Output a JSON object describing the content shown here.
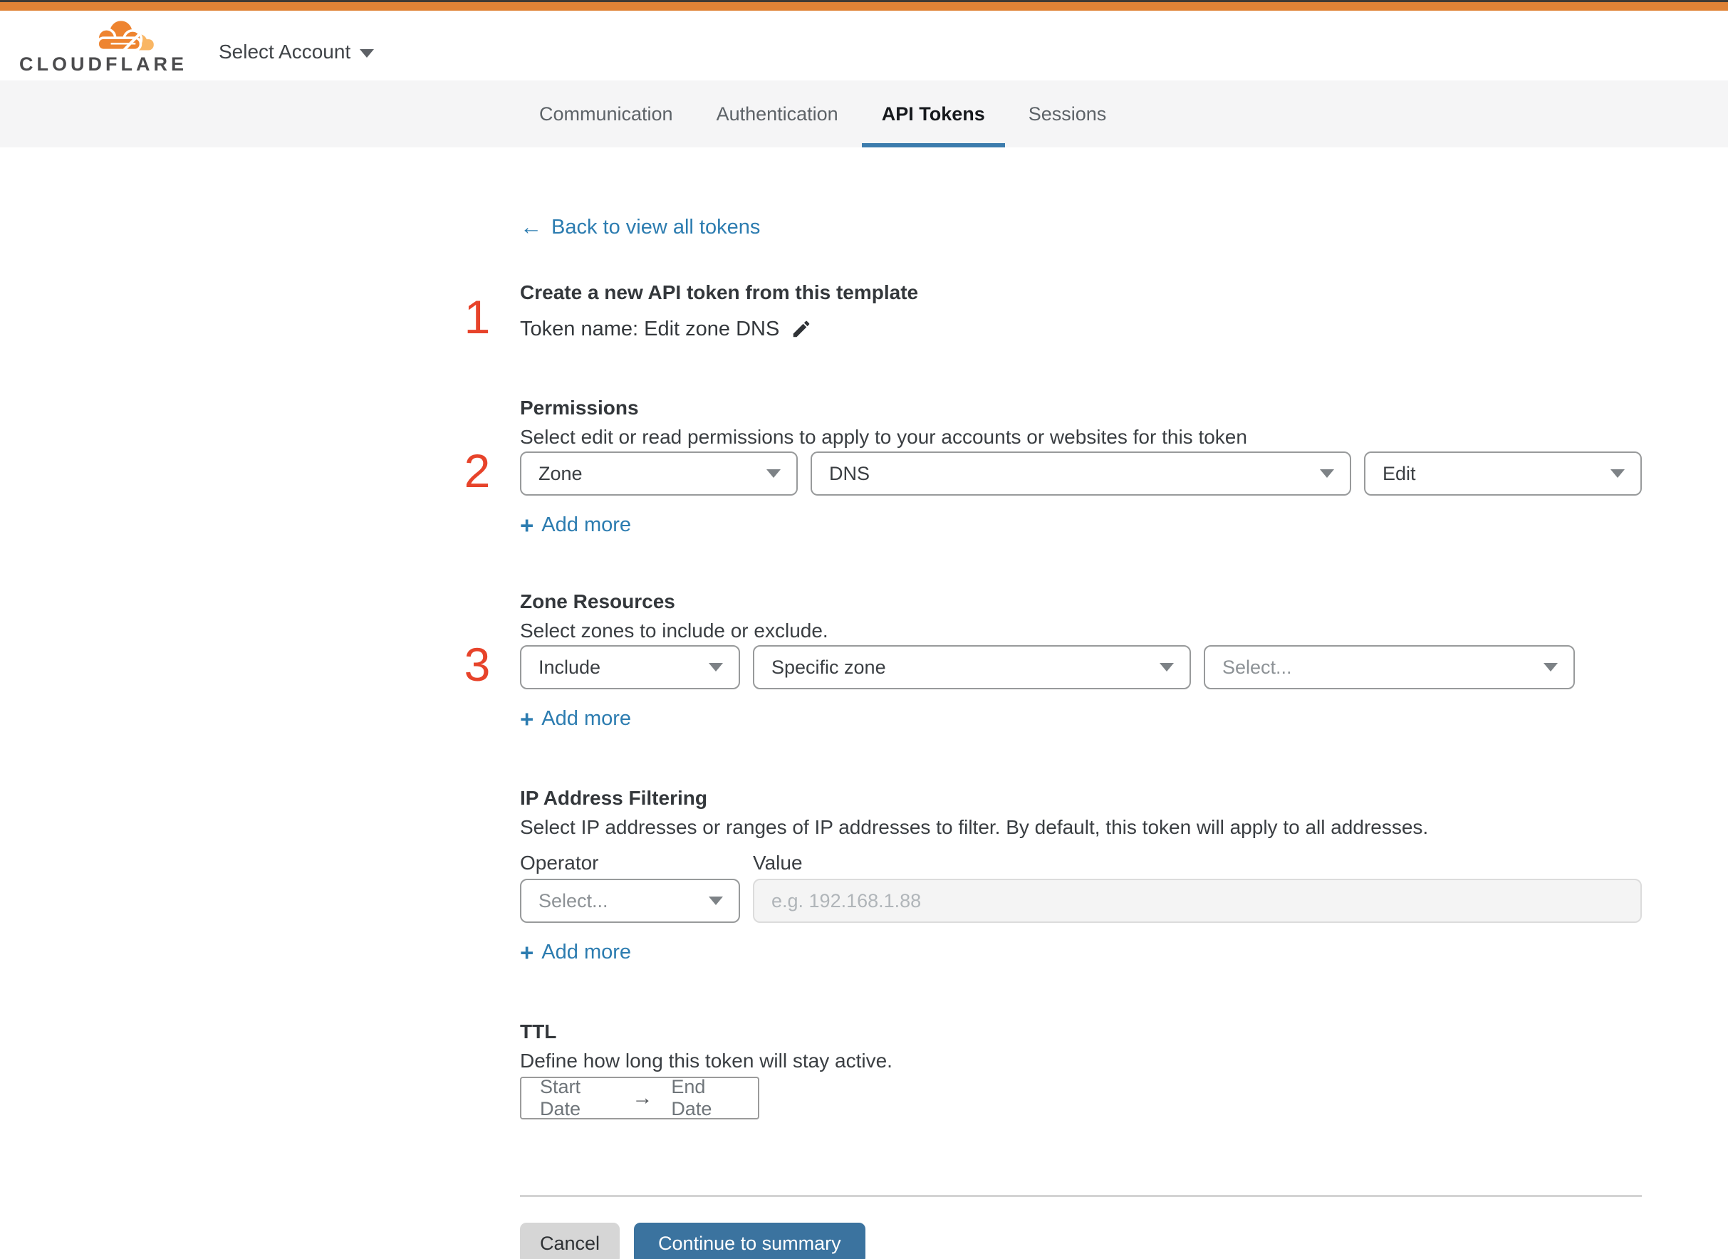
{
  "colors": {
    "accent_orange_bar": "#e08336",
    "brand_orange": "#ee8430",
    "brand_orange_light": "#f9b664",
    "link_blue": "#2c7cb0",
    "button_blue": "#3b739f",
    "tab_underline_blue": "#3c7cad",
    "step_number_red": "#e7432a"
  },
  "icons": {
    "back_arrow": "←",
    "plus": "+",
    "arrow_right": "→",
    "caret_down": "▼",
    "pencil": "edit-pencil"
  },
  "header": {
    "brand": "CLOUDFLARE",
    "account_selector": "Select Account"
  },
  "tabs": [
    {
      "label": "Communication",
      "active": false
    },
    {
      "label": "Authentication",
      "active": false
    },
    {
      "label": "API Tokens",
      "active": true
    },
    {
      "label": "Sessions",
      "active": false
    }
  ],
  "back_link": {
    "label": "Back to view all tokens"
  },
  "template_section": {
    "step": "1",
    "title": "Create a new API token from this template",
    "token_name": "Token name: Edit zone DNS"
  },
  "permissions": {
    "step": "2",
    "heading": "Permissions",
    "description": "Select edit or read permissions to apply to your accounts or websites for this token",
    "selects": [
      {
        "value": "Zone"
      },
      {
        "value": "DNS"
      },
      {
        "value": "Edit"
      }
    ],
    "add_more": "Add more"
  },
  "zone_resources": {
    "step": "3",
    "heading": "Zone Resources",
    "description": "Select zones to include or exclude.",
    "selects": [
      {
        "value": "Include"
      },
      {
        "value": "Specific zone"
      },
      {
        "value": "Select...",
        "placeholder": true
      }
    ],
    "add_more": "Add more"
  },
  "ip_filtering": {
    "heading": "IP Address Filtering",
    "description": "Select IP addresses or ranges of IP addresses to filter. By default, this token will apply to all addresses.",
    "operator_label": "Operator",
    "value_label": "Value",
    "operator_placeholder": "Select...",
    "value_placeholder": "e.g. 192.168.1.88",
    "add_more": "Add more"
  },
  "ttl": {
    "heading": "TTL",
    "description": "Define how long this token will stay active.",
    "start_label": "Start Date",
    "end_label": "End Date"
  },
  "footer": {
    "cancel": "Cancel",
    "continue": "Continue to summary"
  }
}
